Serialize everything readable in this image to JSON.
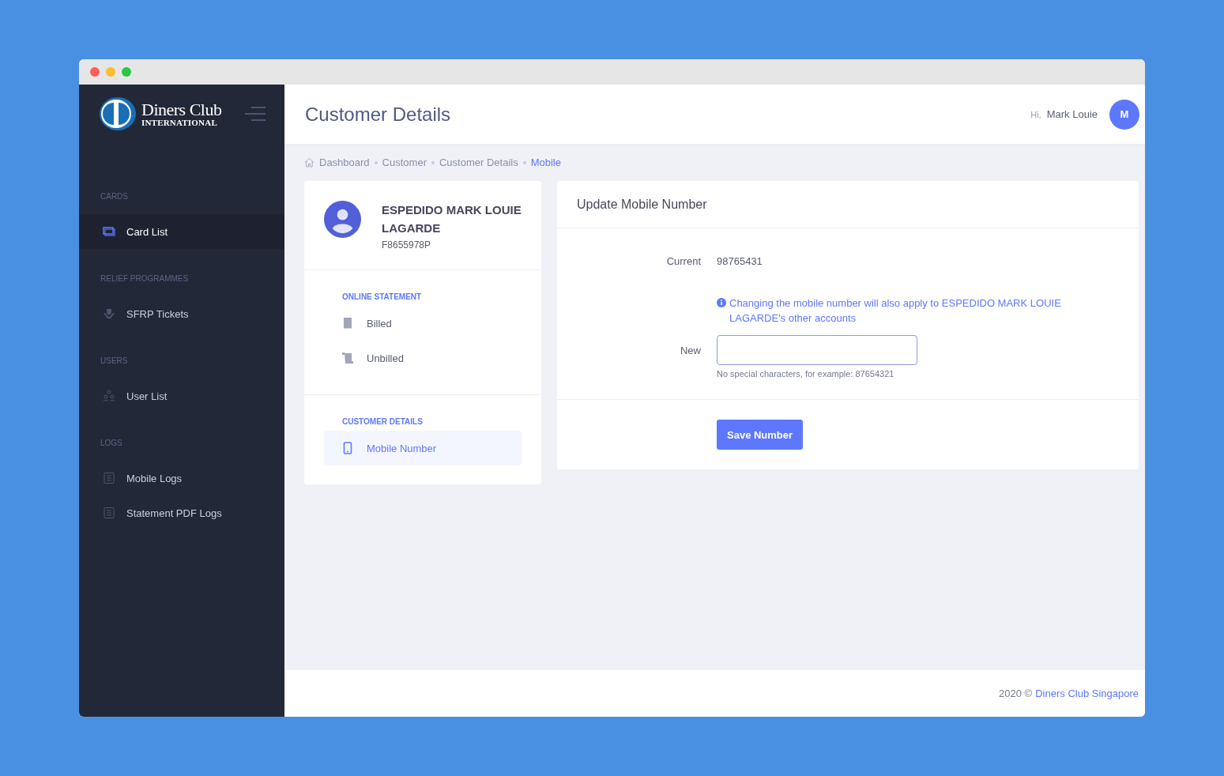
{
  "window": {
    "controls": [
      {
        "color": "#ff5f57"
      },
      {
        "color": "#febc2e"
      },
      {
        "color": "#28c840"
      }
    ]
  },
  "logo": {
    "line_1": "Diners Club",
    "line_2": "INTERNATIONAL"
  },
  "sidebar": {
    "sections": [
      {
        "title": "CARDS",
        "items": [
          {
            "label": "Card List",
            "kind": "card",
            "selected": true
          }
        ]
      },
      {
        "title": "RELIEF PROGRAMMES",
        "items": [
          {
            "label": "SFRP Tickets",
            "kind": "shield",
            "selected": false
          }
        ]
      },
      {
        "title": "USERS",
        "items": [
          {
            "label": "User List",
            "kind": "users",
            "selected": false
          }
        ]
      },
      {
        "title": "LOGS",
        "items": [
          {
            "label": "Mobile Logs",
            "kind": "log",
            "selected": false
          },
          {
            "label": "Statement PDF Logs",
            "kind": "log",
            "selected": false
          }
        ]
      }
    ]
  },
  "header": {
    "title": "Customer Details",
    "greeting": "Hi,",
    "user": "Mark Louie",
    "avatar": "M"
  },
  "breadcrumb": [
    "Dashboard",
    "Customer",
    "Customer Details",
    "Mobile"
  ],
  "customer": {
    "name": "ESPEDIDO MARK LOUIE LAGARDE",
    "id": "F8655978P",
    "sections": [
      {
        "title": "ONLINE STATEMENT",
        "items": [
          {
            "label": "Billed",
            "kind": "receipt",
            "selected": false
          },
          {
            "label": "Unbilled",
            "kind": "scroll",
            "selected": false
          }
        ]
      },
      {
        "title": "CUSTOMER DETAILS",
        "items": [
          {
            "label": "Mobile Number",
            "kind": "phone",
            "selected": true
          }
        ]
      }
    ]
  },
  "form": {
    "title": "Update Mobile Number",
    "current_label": "Current",
    "current_value": "98765431",
    "note": "Changing the mobile number will also apply to ESPEDIDO MARK LOUIE LAGARDE's other accounts",
    "new_label": "New",
    "hint": "No special characters, for example: 87654321",
    "button": "Save Number"
  },
  "footer": {
    "text": "2020 ©",
    "link": "Diners Club Singapore"
  }
}
